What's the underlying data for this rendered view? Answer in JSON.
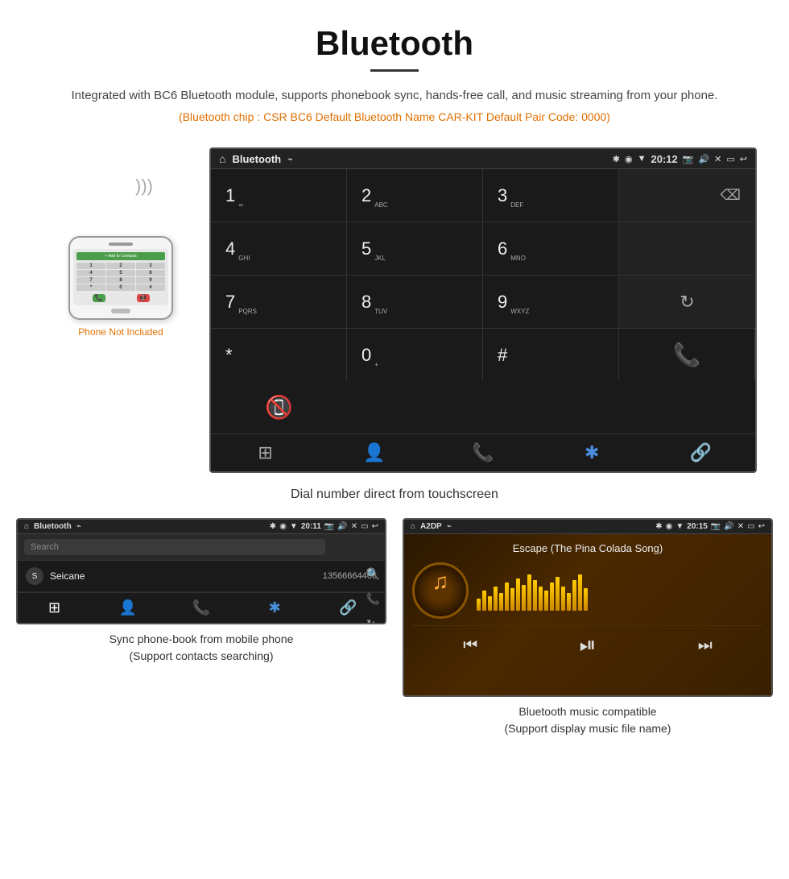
{
  "page": {
    "title": "Bluetooth",
    "subtitle": "Integrated with BC6 Bluetooth module, supports phonebook sync, hands-free call, and music streaming from your phone.",
    "specs": "(Bluetooth chip : CSR BC6    Default Bluetooth Name CAR-KIT    Default Pair Code: 0000)",
    "main_caption": "Dial number direct from touchscreen",
    "bottom_left_caption": "Sync phone-book from mobile phone\n(Support contacts searching)",
    "bottom_right_caption": "Bluetooth music compatible\n(Support display music file name)"
  },
  "main_screen": {
    "status_bar": {
      "title": "Bluetooth",
      "time": "20:12"
    },
    "dialpad": {
      "rows": [
        [
          {
            "digit": "1",
            "sub": "∞"
          },
          {
            "digit": "2",
            "sub": "ABC"
          },
          {
            "digit": "3",
            "sub": "DEF"
          },
          {
            "special": "backspace"
          }
        ],
        [
          {
            "digit": "4",
            "sub": "GHI"
          },
          {
            "digit": "5",
            "sub": "JKL"
          },
          {
            "digit": "6",
            "sub": "MNO"
          },
          {
            "special": "empty"
          }
        ],
        [
          {
            "digit": "7",
            "sub": "PQRS"
          },
          {
            "digit": "8",
            "sub": "TUV"
          },
          {
            "digit": "9",
            "sub": "WXYZ"
          },
          {
            "special": "reload"
          }
        ],
        [
          {
            "digit": "*",
            "sub": ""
          },
          {
            "digit": "0",
            "sub": "+"
          },
          {
            "digit": "#",
            "sub": ""
          },
          {
            "special": "call-green"
          },
          {
            "special": "call-red"
          }
        ]
      ],
      "bottom_nav": [
        "⊞",
        "👤",
        "📞",
        "✱",
        "🔗"
      ]
    }
  },
  "bottom_left_screen": {
    "status_bar": {
      "title": "Bluetooth",
      "time": "20:11"
    },
    "search_placeholder": "Search",
    "contacts": [
      {
        "letter": "S",
        "name": "Seicane",
        "phone": "13566664466"
      }
    ]
  },
  "bottom_right_screen": {
    "status_bar": {
      "title": "A2DP",
      "time": "20:15"
    },
    "song_title": "Escape (The Pina Colada Song)",
    "viz_bars": [
      15,
      25,
      18,
      30,
      22,
      35,
      28,
      40,
      32,
      45,
      38,
      30,
      25,
      35,
      42,
      30,
      22,
      38,
      45,
      28
    ]
  },
  "phone_mockup": {
    "not_included_text": "Phone Not Included",
    "add_contact_label": "+ Add to Contacts",
    "keys": [
      "1",
      "2",
      "3",
      "4",
      "5",
      "6",
      "7",
      "8",
      "9",
      "*",
      "0",
      "#"
    ]
  }
}
